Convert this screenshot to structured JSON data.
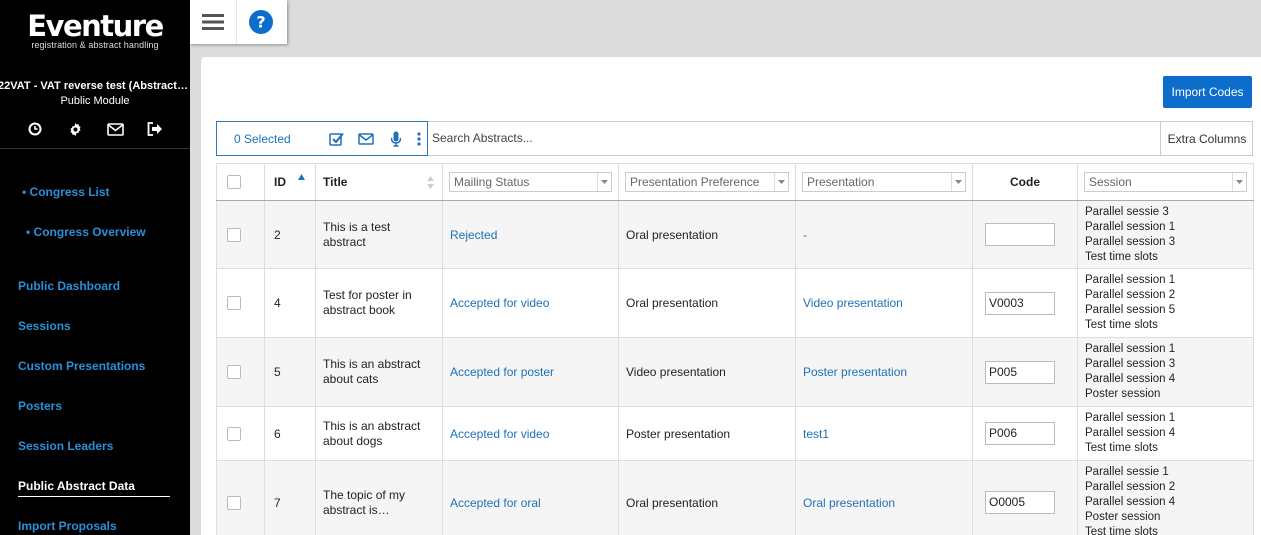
{
  "brand": {
    "name": "Eventure",
    "tagline": "registration & abstract handling"
  },
  "event": {
    "name": "22VAT - VAT reverse test (Abstract…",
    "module": "Public Module"
  },
  "sidebar": {
    "sub_items": [
      {
        "label": "• Congress List"
      },
      {
        "label": "• Congress Overview"
      }
    ],
    "items": [
      {
        "label": "Public Dashboard"
      },
      {
        "label": "Sessions"
      },
      {
        "label": "Custom Presentations"
      },
      {
        "label": "Posters"
      },
      {
        "label": "Session Leaders"
      },
      {
        "label": "Public Abstract Data"
      },
      {
        "label": "Import Proposals"
      }
    ],
    "active_item": "Public Abstract Data"
  },
  "toolbar": {
    "import_label": "Import Codes"
  },
  "actionbar": {
    "selected": "0 Selected",
    "search_placeholder": "Search Abstracts...",
    "extra_columns": "Extra Columns"
  },
  "table": {
    "headers": {
      "id": "ID",
      "title": "Title",
      "code": "Code"
    },
    "filters": {
      "mailing": "Mailing Status",
      "preference": "Presentation Preference",
      "presentation": "Presentation",
      "session": "Session"
    },
    "rows": [
      {
        "id": "2",
        "title": [
          "This is a test abstract"
        ],
        "mailing": "Rejected",
        "preference": "Oral presentation",
        "presentation": "-",
        "code": "",
        "sessions": [
          "Parallel sessie 3",
          "Parallel session 1",
          "Parallel session 3",
          "Test time slots"
        ]
      },
      {
        "id": "4",
        "title": [
          "Test for poster in",
          "abstract book"
        ],
        "mailing": "Accepted for video",
        "preference": "Oral presentation",
        "presentation": "Video presentation",
        "code": "V0003",
        "sessions": [
          "Parallel session 1",
          "Parallel session 2",
          "Parallel session 5",
          "Test time slots"
        ]
      },
      {
        "id": "5",
        "title": [
          "This is an abstract",
          "about cats"
        ],
        "mailing": "Accepted for poster",
        "preference": "Video presentation",
        "presentation": "Poster presentation",
        "code": "P005",
        "sessions": [
          "Parallel session 1",
          "Parallel session 3",
          "Parallel session 4",
          "Poster session"
        ]
      },
      {
        "id": "6",
        "title": [
          "This is an abstract",
          "about dogs"
        ],
        "mailing": "Accepted for video",
        "preference": "Poster presentation",
        "presentation": "test1",
        "code": "P006",
        "sessions": [
          "Parallel session 1",
          "Parallel session 4",
          "Test time slots"
        ]
      },
      {
        "id": "7",
        "title": [
          "The topic of my",
          "abstract is…"
        ],
        "mailing": "Accepted for oral",
        "preference": "Oral presentation",
        "presentation": "Oral presentation",
        "code": "O0005",
        "sessions": [
          "Parallel sessie 1",
          "Parallel session 2",
          "Parallel session 4",
          "Poster session",
          "Test time slots"
        ]
      }
    ]
  }
}
